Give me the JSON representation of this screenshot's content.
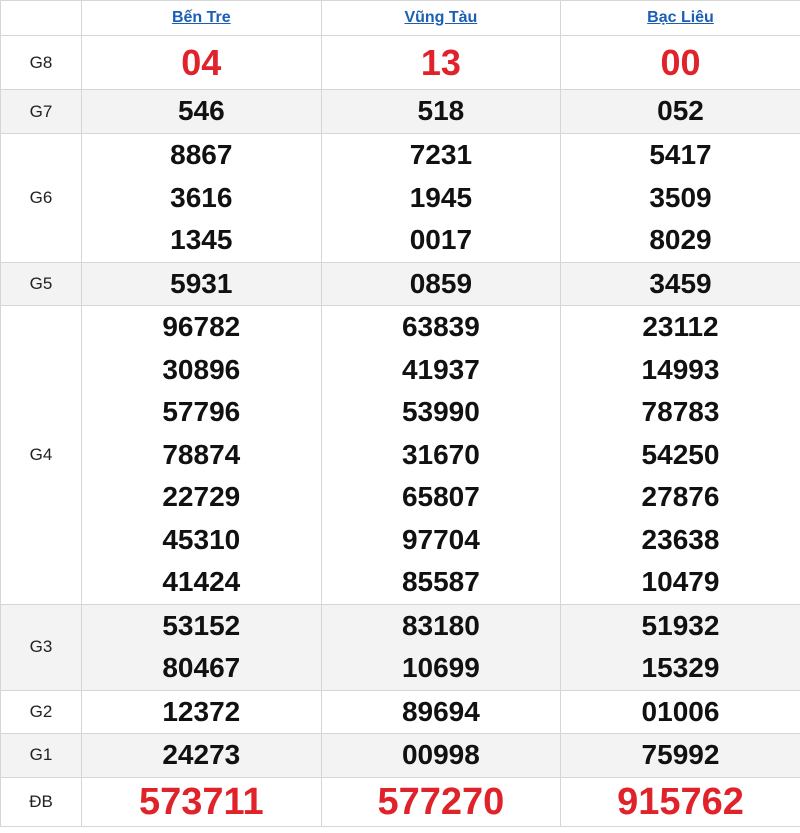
{
  "header": {
    "provinces": [
      "Bến Tre",
      "Vũng Tàu",
      "Bạc Liêu"
    ]
  },
  "rows": {
    "g8": {
      "label": "G8",
      "values": [
        [
          "04"
        ],
        [
          "13"
        ],
        [
          "00"
        ]
      ]
    },
    "g7": {
      "label": "G7",
      "values": [
        [
          "546"
        ],
        [
          "518"
        ],
        [
          "052"
        ]
      ]
    },
    "g6": {
      "label": "G6",
      "values": [
        [
          "8867",
          "3616",
          "1345"
        ],
        [
          "7231",
          "1945",
          "0017"
        ],
        [
          "5417",
          "3509",
          "8029"
        ]
      ]
    },
    "g5": {
      "label": "G5",
      "values": [
        [
          "5931"
        ],
        [
          "0859"
        ],
        [
          "3459"
        ]
      ]
    },
    "g4": {
      "label": "G4",
      "values": [
        [
          "96782",
          "30896",
          "57796",
          "78874",
          "22729",
          "45310",
          "41424"
        ],
        [
          "63839",
          "41937",
          "53990",
          "31670",
          "65807",
          "97704",
          "85587"
        ],
        [
          "23112",
          "14993",
          "78783",
          "54250",
          "27876",
          "23638",
          "10479"
        ]
      ]
    },
    "g3": {
      "label": "G3",
      "values": [
        [
          "53152",
          "80467"
        ],
        [
          "83180",
          "10699"
        ],
        [
          "51932",
          "15329"
        ]
      ]
    },
    "g2": {
      "label": "G2",
      "values": [
        [
          "12372"
        ],
        [
          "89694"
        ],
        [
          "01006"
        ]
      ]
    },
    "g1": {
      "label": "G1",
      "values": [
        [
          "24273"
        ],
        [
          "00998"
        ],
        [
          "75992"
        ]
      ]
    },
    "db": {
      "label": "ĐB",
      "values": [
        [
          "573711"
        ],
        [
          "577270"
        ],
        [
          "915762"
        ]
      ]
    }
  },
  "colors": {
    "link": "#1a5fb4",
    "highlight": "#e0232a",
    "shade": "#f3f3f3",
    "border": "#d6d6d6"
  }
}
